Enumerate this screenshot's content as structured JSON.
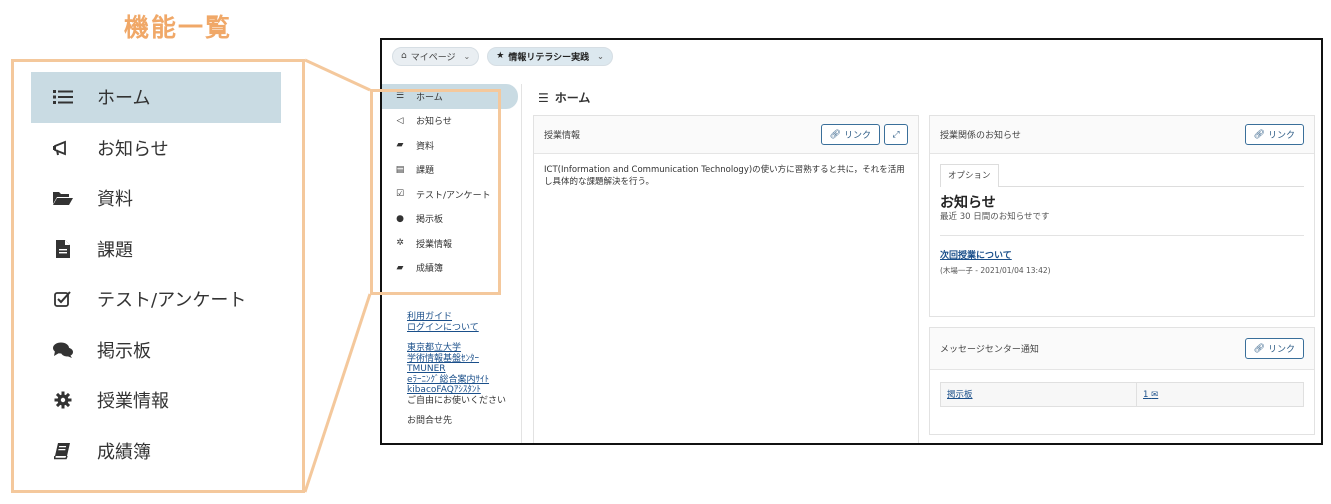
{
  "panel": {
    "title": "機能一覧",
    "items": [
      {
        "label": "ホーム",
        "icon": "list-icon",
        "active": true
      },
      {
        "label": "お知らせ",
        "icon": "megaphone-icon"
      },
      {
        "label": "資料",
        "icon": "folder-open-icon"
      },
      {
        "label": "課題",
        "icon": "file-icon"
      },
      {
        "label": "テスト/アンケート",
        "icon": "check-square-icon"
      },
      {
        "label": "掲示板",
        "icon": "comments-icon"
      },
      {
        "label": "授業情報",
        "icon": "gear-icon"
      },
      {
        "label": "成績簿",
        "icon": "book-icon"
      }
    ],
    "accent": "#f4c89c",
    "active_bg": "#c9dbe3"
  },
  "topbar": {
    "mypage_label": "マイページ",
    "site_label": "情報リテラシー実践"
  },
  "sidebar": {
    "items": [
      {
        "label": "ホーム"
      },
      {
        "label": "お知らせ"
      },
      {
        "label": "資料"
      },
      {
        "label": "課題"
      },
      {
        "label": "テスト/アンケート"
      },
      {
        "label": "掲示板"
      },
      {
        "label": "授業情報"
      },
      {
        "label": "成績簿"
      }
    ],
    "links": {
      "guide": "利用ガイド",
      "login": "ログインについて",
      "univ": "東京都立大学",
      "center": "学術情報基盤ｾﾝﾀｰ",
      "tmuner": "TMUNER",
      "elearning": "eﾗｰﾆﾝｸﾞ総合案内ｻｲﾄ",
      "faq": "kibacoFAQｱｼｽﾀﾝﾄ",
      "free_use": "ご自由にお使いください",
      "contact": "お問合せ先"
    }
  },
  "main": {
    "title": "ホーム",
    "class_info": {
      "header": "授業情報",
      "link_button": "リンク",
      "text": "ICT(Information and Communication Technology)の使い方に習熟すると共に，それを活用し具体的な課題解決を行う。"
    },
    "notices": {
      "header": "授業関係のお知らせ",
      "link_button": "リンク",
      "option_tab": "オプション",
      "title": "お知らせ",
      "subtitle": "最近 30 日間のお知らせです",
      "item_link": "次回授業について",
      "item_meta": "(木場一子 - 2021/01/04 13:42)"
    },
    "message_center": {
      "header": "メッセージセンター通知",
      "link_button": "リンク",
      "row_label": "掲示板",
      "row_count": "1"
    }
  }
}
